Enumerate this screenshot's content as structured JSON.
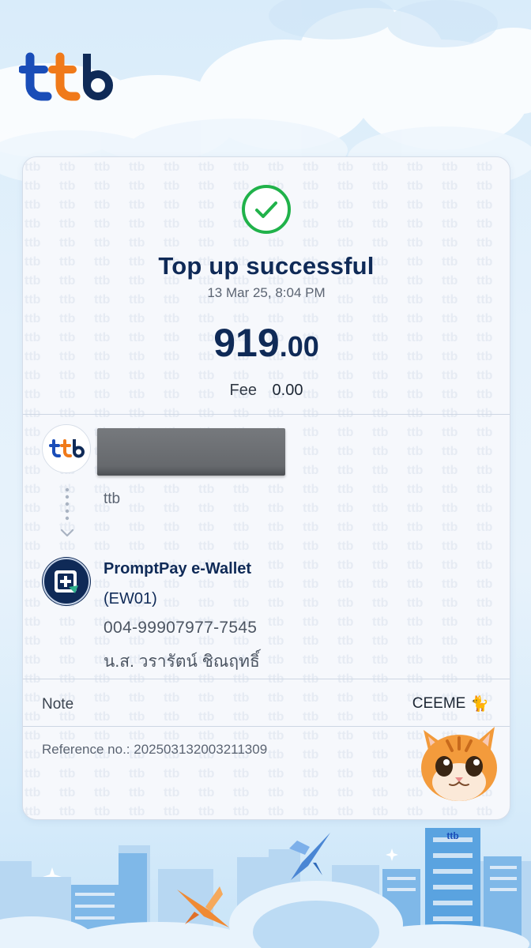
{
  "brand": {
    "logo_text": "ttb",
    "logo_colors": {
      "blue": "#1a4db8",
      "orange": "#f07a1a",
      "navy": "#0f2a57"
    }
  },
  "receipt": {
    "status_title": "Top up successful",
    "status_icon": "check-circle-icon",
    "status_color": "#20b24a",
    "datetime": "13 Mar 25, 8:04 PM",
    "amount_integer": "919",
    "amount_decimal": ".00",
    "fee_label": "Fee",
    "fee_value": "0.00"
  },
  "from": {
    "bank_name": "ttb",
    "account_redacted": true
  },
  "to": {
    "provider": "PromptPay e-Wallet",
    "code": "(EW01)",
    "account_number": "004-99907977-7545",
    "holder_name": "น.ส. วรารัตน์ ชิณฤทธิ์"
  },
  "note": {
    "label": "Note",
    "value": "CEEME",
    "value_emoji": "🐈"
  },
  "reference": {
    "text": "Reference no.: 20250313200321​1309"
  },
  "decor": {
    "cat_sticker": "cat-face-icon",
    "birds": [
      "bird-icon-blue",
      "bird-icon-orange"
    ],
    "building_label": "ttb"
  }
}
